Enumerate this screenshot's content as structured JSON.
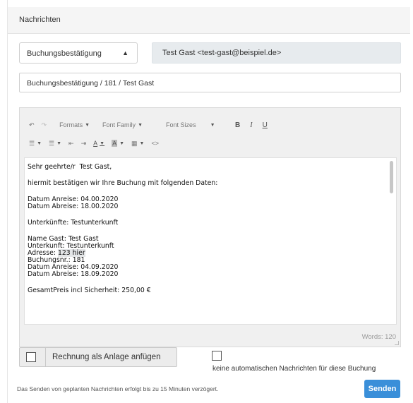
{
  "panel": {
    "title": "Nachrichten"
  },
  "template_select": {
    "value": "Buchungsbestätigung"
  },
  "recipient": {
    "value": "Test Gast <test-gast@beispiel.de>"
  },
  "subject": {
    "value": "Buchungsbestätigung / 181 / Test Gast"
  },
  "toolbar": {
    "formats": "Formats",
    "font_family": "Font Family",
    "font_sizes": "Font Sizes",
    "bold": "B",
    "italic": "I",
    "underline": "U",
    "text_color": "A",
    "bg_color": "A",
    "code": "<>"
  },
  "body_lines": {
    "l1": "Sehr geehrte/r  Test Gast,",
    "l2": "hiermit bestätigen wir Ihre Buchung mit folgenden Daten:",
    "l3": "Datum Anreise: 04.00.2020",
    "l4": "Datum Abreise: 18.00.2020",
    "l5": "Unterkünfte: Testunterkunft",
    "l6": "Name Gast: Test Gast",
    "l7": "Unterkunft: Testunterkunft",
    "l8a": "Adresse: ",
    "l8b": "123 hier",
    "l9": "Buchungsnr.: 181",
    "l10": "Datum Anreise: 04.09.2020",
    "l11": "Datum Abreise: 18.09.2020",
    "l12": "GesamtPreis incl Sicherheit: 250,00 €"
  },
  "word_count": "Words: 120",
  "attach": {
    "label": "Rechnung als Anlage anfügen",
    "checked": false
  },
  "no_auto": {
    "label": "keine automatischen Nachrichten für diese Buchung",
    "checked": false
  },
  "footer_note": "Das Senden von geplanten Nachrichten erfolgt bis zu 15 Minuten verzögert.",
  "send_button": "Senden",
  "colors": {
    "send": "#3a8fd9",
    "recipient_bg": "#e7ebee",
    "editor_bg": "#f0f0f0"
  }
}
